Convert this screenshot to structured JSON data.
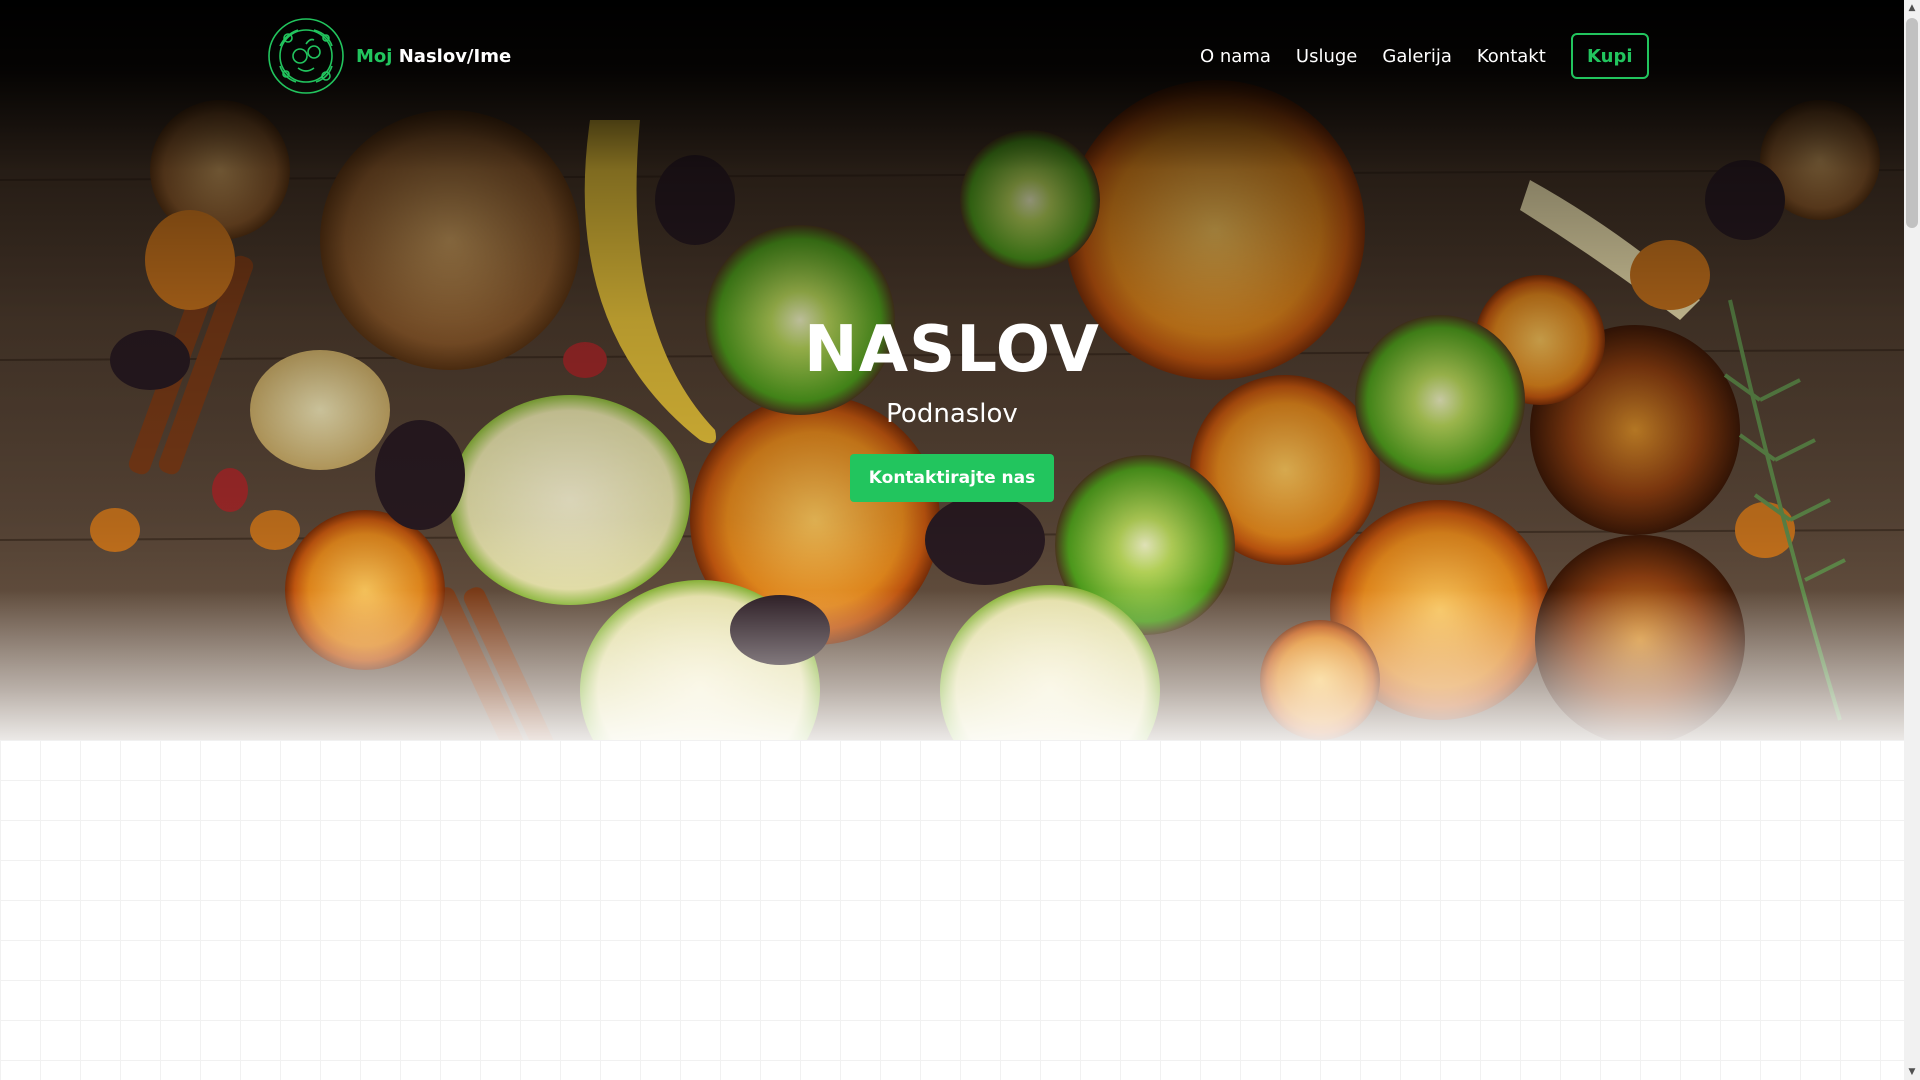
{
  "brand": {
    "logo_icon": "fruit-vegetable-wreath-logo",
    "prefix": "Moj",
    "name": "Naslov/Ime"
  },
  "nav": {
    "links": [
      "O nama",
      "Usluge",
      "Galerija",
      "Kontakt"
    ],
    "buy_label": "Kupi"
  },
  "hero": {
    "background": "dried-fruit-photo",
    "title": "NASLOV",
    "subtitle": "Podnaslov",
    "cta_label": "Kontaktirajte nas"
  },
  "colors": {
    "accent": "#22c55e",
    "nav_text": "#ffffff",
    "page_background": "#ffffff"
  },
  "scrollbar": {
    "up_icon": "arrow-up-icon",
    "down_icon": "arrow-down-icon"
  }
}
